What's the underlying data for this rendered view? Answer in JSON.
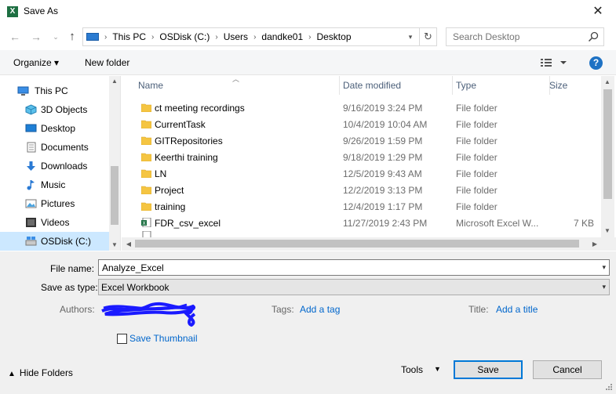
{
  "window": {
    "title": "Save As",
    "app_icon": "excel-icon",
    "close_label": "✕"
  },
  "address": {
    "crumbs": [
      "This PC",
      "OSDisk (C:)",
      "Users",
      "dandke01",
      "Desktop"
    ],
    "search_placeholder": "Search Desktop"
  },
  "toolbar": {
    "organize_label": "Organize ▾",
    "new_folder_label": "New folder",
    "help_label": "?"
  },
  "nav_pane": {
    "items": [
      {
        "label": "This PC",
        "icon": "computer-icon"
      },
      {
        "label": "3D Objects",
        "icon": "3d-objects-icon"
      },
      {
        "label": "Desktop",
        "icon": "desktop-icon"
      },
      {
        "label": "Documents",
        "icon": "documents-icon"
      },
      {
        "label": "Downloads",
        "icon": "downloads-icon"
      },
      {
        "label": "Music",
        "icon": "music-icon"
      },
      {
        "label": "Pictures",
        "icon": "pictures-icon"
      },
      {
        "label": "Videos",
        "icon": "videos-icon"
      },
      {
        "label": "OSDisk (C:)",
        "icon": "drive-icon"
      }
    ]
  },
  "file_list": {
    "columns": {
      "name": "Name",
      "date": "Date modified",
      "type": "Type",
      "size": "Size"
    },
    "rows": [
      {
        "name": "ct meeting recordings",
        "date": "9/16/2019 3:24 PM",
        "type": "File folder",
        "size": ""
      },
      {
        "name": "CurrentTask",
        "date": "10/4/2019 10:04 AM",
        "type": "File folder",
        "size": ""
      },
      {
        "name": "GITRepositories",
        "date": "9/26/2019 1:59 PM",
        "type": "File folder",
        "size": ""
      },
      {
        "name": "Keerthi training",
        "date": "9/18/2019 1:29 PM",
        "type": "File folder",
        "size": ""
      },
      {
        "name": "LN",
        "date": "12/5/2019 9:43 AM",
        "type": "File folder",
        "size": ""
      },
      {
        "name": "Project",
        "date": "12/2/2019 3:13 PM",
        "type": "File folder",
        "size": ""
      },
      {
        "name": "training",
        "date": "12/4/2019 1:17 PM",
        "type": "File folder",
        "size": ""
      },
      {
        "name": "FDR_csv_excel",
        "date": "11/27/2019 2:43 PM",
        "type": "Microsoft Excel W...",
        "size": "7 KB"
      }
    ]
  },
  "form": {
    "file_name_label": "File name:",
    "file_name_value": "Analyze_Excel",
    "save_type_label": "Save as type:",
    "save_type_value": "Excel Workbook",
    "authors_label": "Authors:",
    "tags_label": "Tags:",
    "tags_link": "Add a tag",
    "title_label": "Title:",
    "title_link": "Add a title",
    "thumbnail_label": "Save Thumbnail"
  },
  "footer": {
    "hide_folders_label": "Hide Folders",
    "tools_label": "Tools",
    "save_label": "Save",
    "cancel_label": "Cancel"
  },
  "colors": {
    "accent": "#0078d7",
    "link": "#0066cc",
    "selected": "#cce8ff",
    "folder": "#f5c542",
    "excel": "#1d6f42",
    "scribble": "#1a1aff"
  }
}
